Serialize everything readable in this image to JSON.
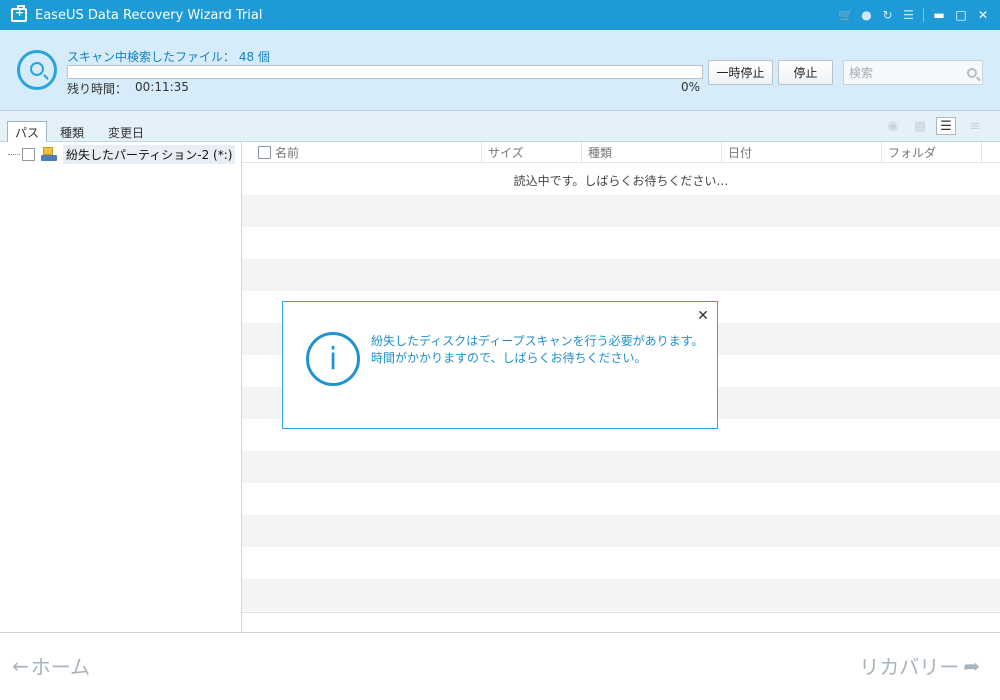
{
  "window": {
    "title": "EaseUS Data Recovery Wizard Trial",
    "controls": {
      "cart": "🛒",
      "chat": "●",
      "refresh": "↻",
      "menu": "☰",
      "minimize": "▬",
      "maximize": "□",
      "close": "✕"
    }
  },
  "scan": {
    "status": "スキャン中検索したファイル： 48 個",
    "time_label": "残り時間：",
    "time_value": "00:11:35",
    "percent": "0%",
    "progress": 0,
    "pause_label": "一時停止",
    "stop_label": "停止",
    "search_placeholder": "検索"
  },
  "tabs": {
    "path": "パス",
    "type": "種類",
    "date": "変更日"
  },
  "tree": {
    "items": [
      {
        "label": "紛失したパーティション-2 (*:)"
      }
    ]
  },
  "filelist": {
    "columns": {
      "name": "名前",
      "size": "サイズ",
      "type": "種類",
      "date": "日付",
      "folder": "フォルダ"
    },
    "loading": "読込中です。しばらくお待ちください…"
  },
  "dialog": {
    "icon": "i",
    "message": "紛失したディスクはディープスキャンを行う必要があります。時間がかかりますので、しばらくお待ちください。",
    "close": "✕"
  },
  "footer": {
    "home_label": "ホーム",
    "recover_label": "リカバリー"
  },
  "colors": {
    "accent": "#1e9bd7",
    "scan_bg": "#d6ecfa"
  }
}
